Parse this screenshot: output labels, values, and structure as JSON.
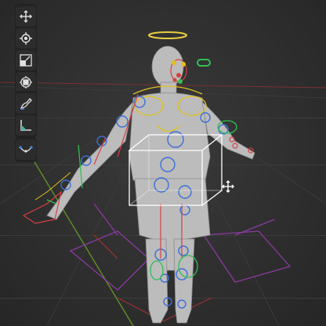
{
  "viewport": {
    "background": "#2f2f2f",
    "grid_color": "#3c3c3c",
    "axis_x_color": "#8a3a3a",
    "axis_y_color": "#6f8a2a"
  },
  "toolbar": {
    "groups": [
      {
        "tools": [
          {
            "name": "move-tool",
            "icon": "move-arrows-icon"
          },
          {
            "name": "rotate-tool",
            "icon": "rotate-icon"
          },
          {
            "name": "scale-tool",
            "icon": "scale-icon"
          },
          {
            "name": "transform-tool",
            "icon": "transform-icon"
          }
        ]
      },
      {
        "tools": [
          {
            "name": "annotate-tool",
            "icon": "pen-curve-icon"
          },
          {
            "name": "measure-tool",
            "icon": "ruler-angle-icon"
          }
        ]
      },
      {
        "tools": [
          {
            "name": "curve-tool",
            "icon": "bezier-curve-icon"
          }
        ]
      }
    ]
  },
  "colors": {
    "active_tool": "#ffffff",
    "tool_icon": "#d8d8d8",
    "bone_blue": "#3c6fd8",
    "bone_red": "#d84040",
    "bone_yellow": "#e0c020",
    "bone_green": "#30c050",
    "bone_magenta": "#a040c0",
    "selection_box": "#ffffff",
    "halo": "#e8d040",
    "mesh": "#b9b9b9"
  }
}
